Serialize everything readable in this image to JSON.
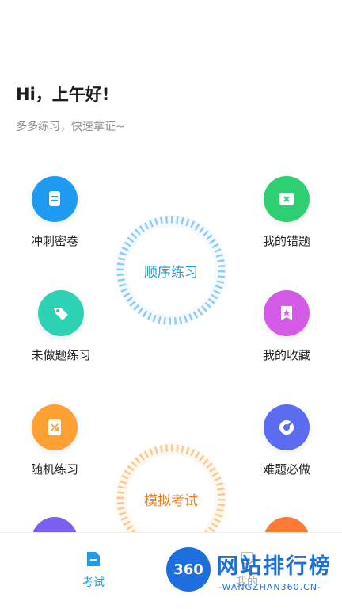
{
  "header": {
    "greeting": "Hi，上午好!",
    "subtitle": "多多练习，快速拿证~"
  },
  "features": {
    "left": [
      {
        "label": "冲刺密卷",
        "icon": "document-icon",
        "color": "#1e9bf0"
      },
      {
        "label": "未做题练习",
        "icon": "tag-icon",
        "color": "#2dd2b4"
      },
      {
        "label": "随机练习",
        "icon": "shuffle-icon",
        "color": "#ffa033"
      }
    ],
    "right": [
      {
        "label": "我的错题",
        "icon": "wrong-card-icon",
        "color": "#2ecf71"
      },
      {
        "label": "我的收藏",
        "icon": "bookmark-star-icon",
        "color": "#d35be6"
      },
      {
        "label": "难题必做",
        "icon": "target-icon",
        "color": "#5b6cf0"
      }
    ]
  },
  "rings": {
    "sequence": {
      "label": "顺序练习",
      "color": "#1f9be7"
    },
    "mock": {
      "label": "模拟考试",
      "color": "#f57f17"
    }
  },
  "tabbar": {
    "tabs": [
      {
        "label": "考试",
        "icon": "exam-doc-icon",
        "active": true,
        "color": "#1e9bf0"
      },
      {
        "label": "我的",
        "icon": "profile-icon",
        "active": false,
        "color": "#aaaaaa"
      }
    ]
  },
  "watermark": {
    "logo_text": "360",
    "title": "网站排行榜",
    "url": "-WANGZHAN360.CN-"
  }
}
